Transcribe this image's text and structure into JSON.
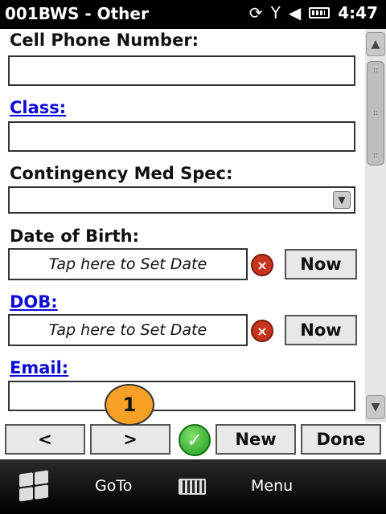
{
  "status_bar": {
    "title": "001BWS - Other",
    "time": "4:47"
  },
  "form": {
    "cell_phone_label": "Cell Phone Number:",
    "cell_phone_value": "",
    "class_label": "Class:",
    "class_value": "",
    "contingency_label": "Contingency Med Spec:",
    "contingency_value": "",
    "dob_label": "Date of Birth:",
    "dob_placeholder": "Tap here to Set Date",
    "dob2_label": "DOB:",
    "dob2_placeholder": "Tap here to Set Date",
    "email_label": "Email:",
    "email_value": "",
    "now_label": "Now",
    "clear_glyph": "×"
  },
  "nav": {
    "prev_label": "<",
    "next_label": ">",
    "new_label": "New",
    "done_label": "Done",
    "badge": "1"
  },
  "taskbar": {
    "goto_label": "GoTo",
    "menu_label": "Menu"
  },
  "icons": [
    "windows-start-icon",
    "keyboard-icon",
    "sync-icon",
    "signal-icon",
    "volume-icon",
    "battery-icon",
    "checkmark-icon"
  ]
}
